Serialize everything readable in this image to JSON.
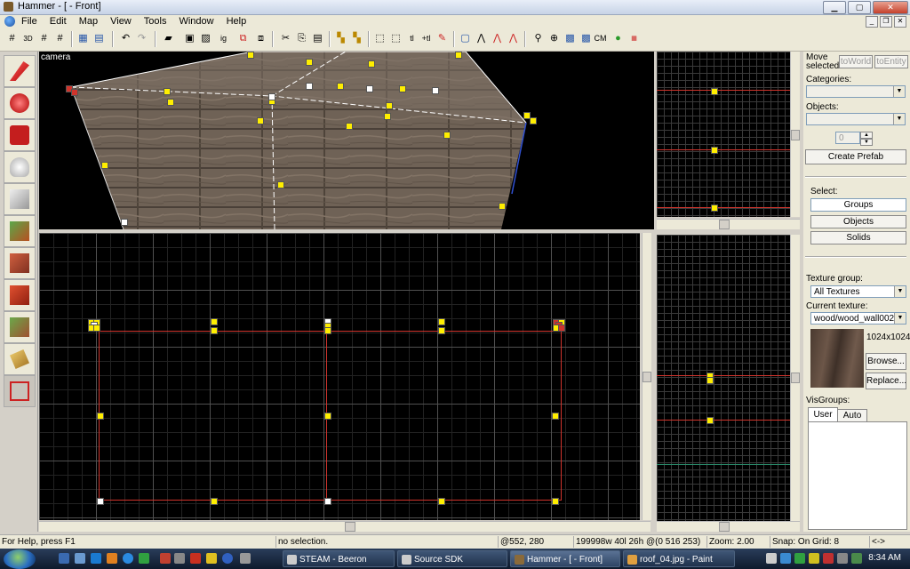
{
  "window": {
    "title": "Hammer - [ - Front]"
  },
  "menu": [
    "File",
    "Edit",
    "Map",
    "View",
    "Tools",
    "Window",
    "Help"
  ],
  "viewports": {
    "camera_label": "camera"
  },
  "panel": {
    "move_selected": "Move selected:",
    "to_world": "toWorld",
    "to_entity": "toEntity",
    "categories": "Categories:",
    "objects_label": "Objects:",
    "spinner_value": "0",
    "create_prefab": "Create Prefab",
    "select_label": "Select:",
    "groups": "Groups",
    "objects": "Objects",
    "solids": "Solids",
    "texture_group_label": "Texture group:",
    "texture_group_value": "All Textures",
    "current_texture_label": "Current texture:",
    "current_texture_value": "wood/wood_wall002",
    "texture_size": "1024x1024",
    "browse": "Browse...",
    "replace": "Replace...",
    "visgroups_label": "VisGroups:",
    "tab_user": "User",
    "tab_auto": "Auto"
  },
  "status": {
    "help": "For Help, press F1",
    "selection": "no selection.",
    "coords": "@552, 280",
    "dims": "199998w 40l 26h @(0 516 253)",
    "zoom": "Zoom: 2.00",
    "snap": "Snap: On Grid: 8",
    "arrows": "<->"
  },
  "taskbar": {
    "tasks": [
      "STEAM - Beeron",
      "Source SDK",
      "Hammer - [ - Front]",
      "roof_04.jpg - Paint"
    ],
    "clock": "8:34 AM"
  },
  "colors": {
    "handle": "#ffee00",
    "brush_edge": "#d0342c",
    "grid_bg": "#000000"
  }
}
